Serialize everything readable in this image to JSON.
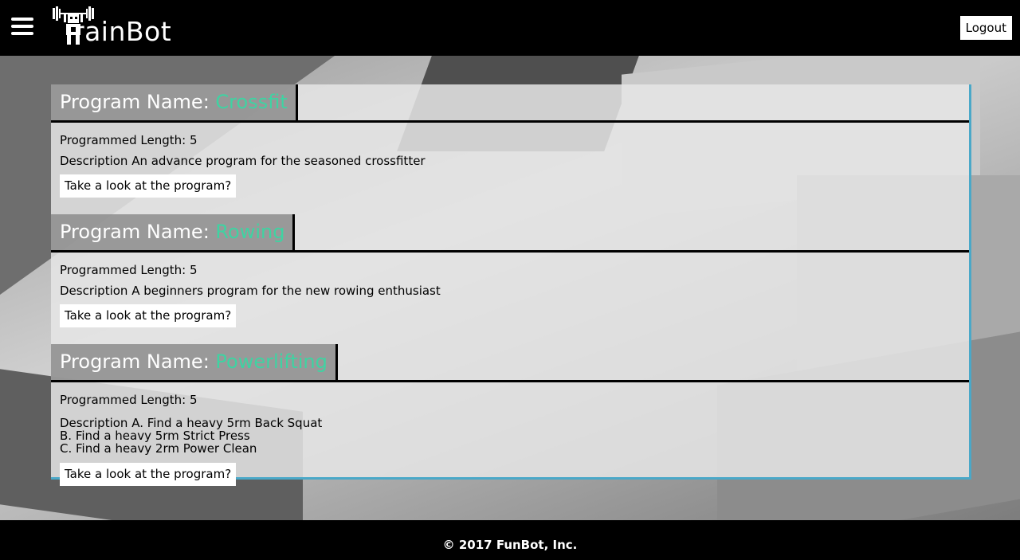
{
  "header": {
    "logo_text": "rainBot",
    "logout_label": "Logout"
  },
  "programs": [
    {
      "label": "Program Name: ",
      "name": "Crossfit",
      "length": "Programmed Length: 5",
      "description": [
        "Description An advance program for the seasoned crossfitter"
      ],
      "button": "Take a look at the program?"
    },
    {
      "label": "Program Name: ",
      "name": "Rowing",
      "length": "Programmed Length: 5",
      "description": [
        "Description A beginners program for the new rowing enthusiast"
      ],
      "button": "Take a look at the program?"
    },
    {
      "label": "Program Name: ",
      "name": "Powerlifting",
      "length": "Programmed Length: 5",
      "description": [
        "Description A. Find a heavy 5rm Back Squat",
        "B. Find a heavy 5rm Strict Press",
        "C. Find a heavy 2rm Power Clean"
      ],
      "button": "Take a look at the program?"
    }
  ],
  "footer": {
    "copyright": "© 2017 FunBot, Inc."
  },
  "colors": {
    "accent_name": "#3fd3a2",
    "panel_border": "#4aa8c8"
  }
}
